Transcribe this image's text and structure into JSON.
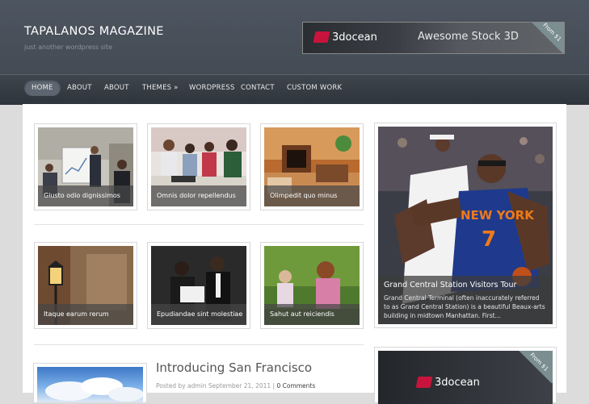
{
  "header": {
    "site_title": "TAPALANOS MAGAZINE",
    "tagline": "just another wordpress site",
    "ad": {
      "brand": "3docean",
      "slogan": "Awesome Stock 3D",
      "ribbon": "From $1"
    }
  },
  "nav": {
    "items": [
      {
        "label": "HOME",
        "active": true
      },
      {
        "label": "ABOUT"
      },
      {
        "label": "ABOUT"
      },
      {
        "label": "THEMES »"
      },
      {
        "label": "WORDPRESS"
      },
      {
        "label": "CONTACT"
      },
      {
        "label": "CUSTOM WORK"
      }
    ]
  },
  "grid": [
    {
      "caption": "Giusto odio dignissimos"
    },
    {
      "caption": "Omnis dolor repellendus"
    },
    {
      "caption": "Olimpedit quo minus"
    },
    {
      "caption": "Itaque earum rerum"
    },
    {
      "caption": "Epudiandae sint molestiae"
    },
    {
      "caption": "Sahut aut reiciendis"
    }
  ],
  "feature": {
    "title": "Grand Central Station Visitors Tour",
    "text": "Grand Central Terminal (often inaccurately referred to as Grand Central Station) is a beautiful Beaux-arts building in midtown Manhattan. First…",
    "jersey_team": "NEW YORK",
    "jersey_number": "7"
  },
  "side_ad": {
    "brand": "3docean",
    "ribbon": "From $1"
  },
  "post": {
    "title": "Introducing San Francisco",
    "meta_prefix": "Posted by admin September 21, 2011 |",
    "comments": "0 Comments"
  },
  "colors": {
    "header_bg": "#4a525c",
    "nav_bg": "#353b42",
    "ad_red": "#c8143c",
    "caption_overlay": "rgba(70,70,70,0.72)"
  }
}
